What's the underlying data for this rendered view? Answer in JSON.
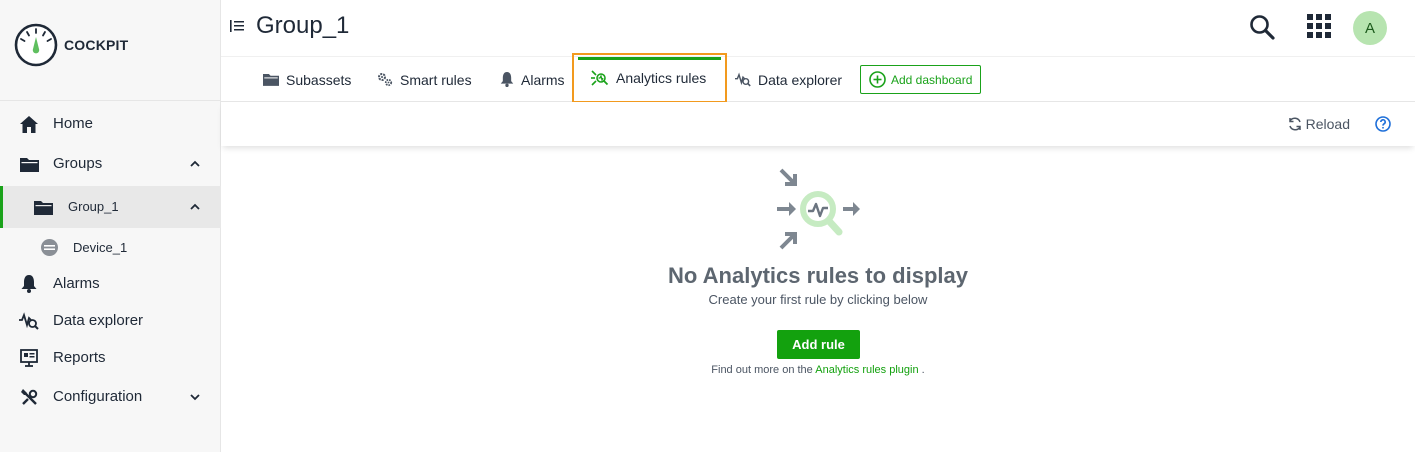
{
  "brand": {
    "name": "COCKPIT"
  },
  "sidebar": {
    "items": [
      {
        "label": "Home",
        "icon": "home-icon"
      },
      {
        "label": "Groups",
        "icon": "folder-icon"
      },
      {
        "label": "Group_1",
        "icon": "folder-icon"
      },
      {
        "label": "Device_1",
        "icon": "device-icon"
      },
      {
        "label": "Alarms",
        "icon": "bell-icon"
      },
      {
        "label": "Data explorer",
        "icon": "data-explorer-icon"
      },
      {
        "label": "Reports",
        "icon": "reports-icon"
      },
      {
        "label": "Configuration",
        "icon": "configuration-icon"
      }
    ]
  },
  "header": {
    "title": "Group_1",
    "avatar_initial": "A"
  },
  "tabs": [
    {
      "label": "Subassets",
      "icon": "folder-icon"
    },
    {
      "label": "Smart rules",
      "icon": "cogs-icon"
    },
    {
      "label": "Alarms",
      "icon": "bell-icon"
    },
    {
      "label": "Analytics rules",
      "icon": "analytics-icon"
    },
    {
      "label": "Data explorer",
      "icon": "data-explorer-icon"
    }
  ],
  "add_dashboard": {
    "label": "Add dashboard"
  },
  "actionbar": {
    "reload_label": "Reload"
  },
  "empty_state": {
    "title": "No Analytics rules to display",
    "subtitle": "Create your first rule by clicking below",
    "button_label": "Add rule",
    "find_more_prefix": "Find out more on the",
    "find_more_link": "Analytics rules plugin",
    "find_more_suffix": "."
  },
  "colors": {
    "accent_green": "#1aa21a",
    "highlight_orange": "#f29a1e",
    "avatar_bg": "#b7e4b0"
  }
}
